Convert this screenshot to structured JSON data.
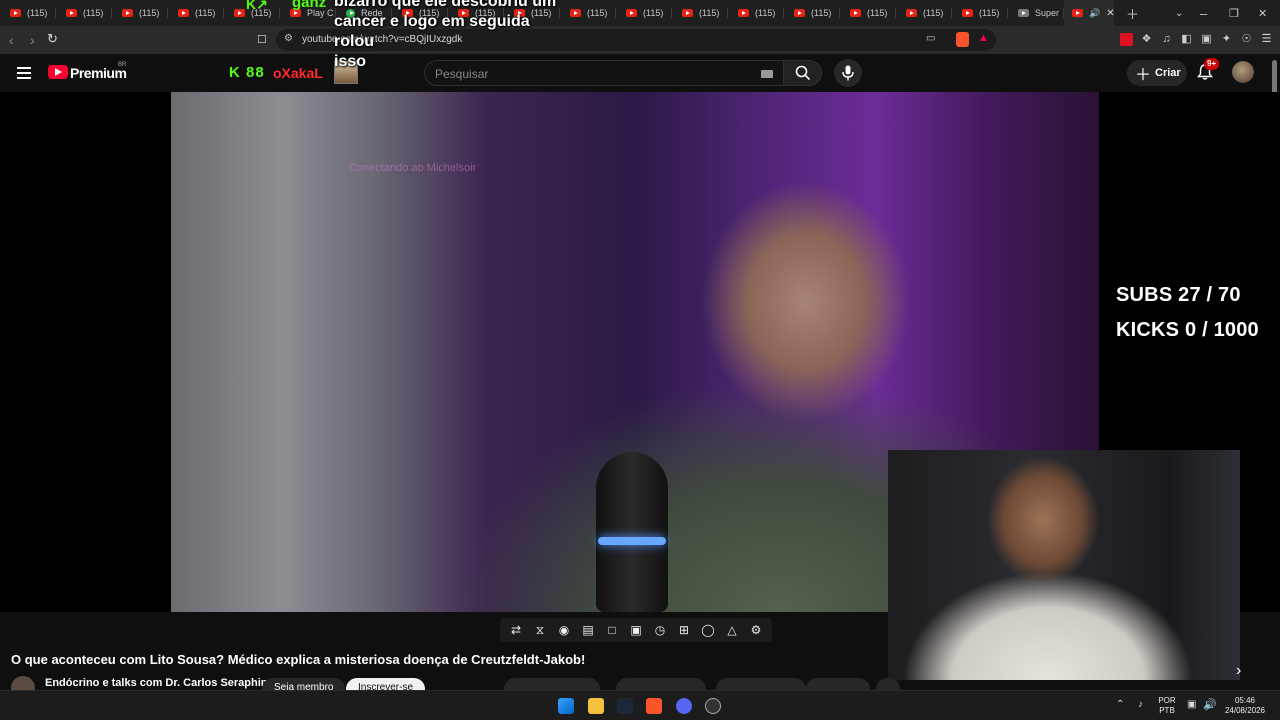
{
  "browser": {
    "tab_label": "(115)",
    "tab_play": "Play C",
    "tab_rede": "Rede",
    "tab_super": "Super",
    "url": "youtube.com/watch?v=cBQjIUxzgdk"
  },
  "overlay": {
    "title_top": "bizarro que ele descobriu um",
    "title_line2": "cancer e logo em seguida rolou",
    "title_line3": "isso",
    "kick_name_top": "ganz",
    "subs": "SUBS 27 / 70",
    "kicks": "KICKS 0 / 1000",
    "connecting": "Conectando ao Michelsoir"
  },
  "youtube": {
    "brand": "Premium",
    "country": "BR",
    "kick_logo": "K 88",
    "streamer": "oXakaL",
    "search_placeholder": "Pesquisar",
    "create_label": "Criar",
    "notif_count": "9+",
    "video_title": "O que aconteceu com Lito Sousa? Médico explica a misteriosa doença de Creutzfeldt-Jakob!",
    "channel": "Endócrino e talks com Dr. Carlos Seraphim",
    "join_label": "Seja membro",
    "subscribe_label": "Inscrever-se"
  },
  "taskbar": {
    "lang_top": "POR",
    "lang_bottom": "PTB",
    "time": "05:46",
    "date": "24/08/2026"
  },
  "colors": {
    "yt_red": "#ff0033",
    "kick_green": "#53fc18",
    "streamer_red": "#ff2a2a",
    "notif_red": "#cc0000"
  }
}
